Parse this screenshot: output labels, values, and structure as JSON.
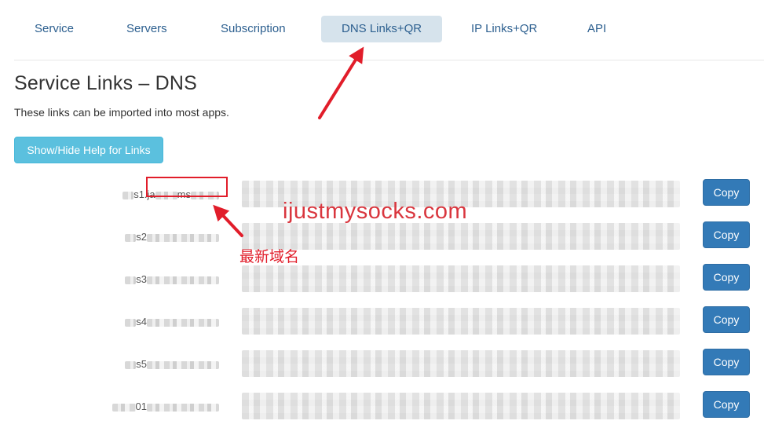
{
  "tabs": [
    {
      "label": "Service",
      "active": false
    },
    {
      "label": "Servers",
      "active": false
    },
    {
      "label": "Subscription",
      "active": false
    },
    {
      "label": "DNS Links+QR",
      "active": true
    },
    {
      "label": "IP Links+QR",
      "active": false
    },
    {
      "label": "API",
      "active": false
    }
  ],
  "page": {
    "title": "Service Links – DNS",
    "subtitle": "These links can be imported into most apps.",
    "help_button": "Show/Hide Help for Links"
  },
  "links": [
    {
      "label_visible": "s1.ja",
      "label_tail": "ms",
      "copy": "Copy"
    },
    {
      "label_visible": "s2",
      "label_tail": "",
      "copy": "Copy"
    },
    {
      "label_visible": "s3",
      "label_tail": "",
      "copy": "Copy"
    },
    {
      "label_visible": "s4",
      "label_tail": "",
      "copy": "Copy"
    },
    {
      "label_visible": "s5",
      "label_tail": "",
      "copy": "Copy"
    },
    {
      "label_visible": "01",
      "label_tail": "",
      "copy": "Copy"
    }
  ],
  "overlay": {
    "watermark": "ijustmysocks.com",
    "annotation": "最新域名",
    "arrow_color": "#e11d2a"
  },
  "colors": {
    "tab_active_bg": "#d6e3ec",
    "tab_text": "#2c5f8f",
    "help_button_bg": "#5bc0de",
    "copy_button_bg": "#337ab7"
  }
}
